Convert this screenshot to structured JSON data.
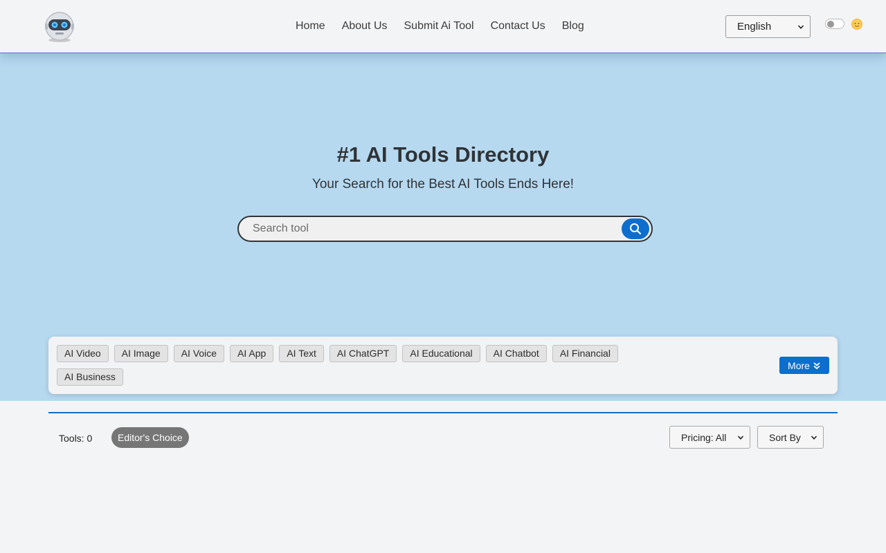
{
  "header": {
    "logo": "robot-logo",
    "nav": [
      "Home",
      "About Us",
      "Submit Ai Tool",
      "Contact Us",
      "Blog"
    ],
    "language": "English",
    "theme_icon": "sun-icon"
  },
  "hero": {
    "title": "#1 AI Tools Directory",
    "subtitle": "Your Search for the Best AI Tools Ends Here!",
    "search_placeholder": "Search tool"
  },
  "categories": {
    "items": [
      "AI Video",
      "AI Image",
      "AI Voice",
      "AI App",
      "AI Text",
      "AI ChatGPT",
      "AI Educational",
      "AI Chatbot",
      "AI Financial",
      "AI Business"
    ],
    "more_label": "More"
  },
  "toolbar": {
    "tools_count": "Tools: 0",
    "editors_choice": "Editor's Choice",
    "pricing": "Pricing: All",
    "sort": "Sort By"
  },
  "colors": {
    "accent": "#0d6ece",
    "hero_bg": "#b6d9f0",
    "page_bg": "#f3f4f6"
  }
}
